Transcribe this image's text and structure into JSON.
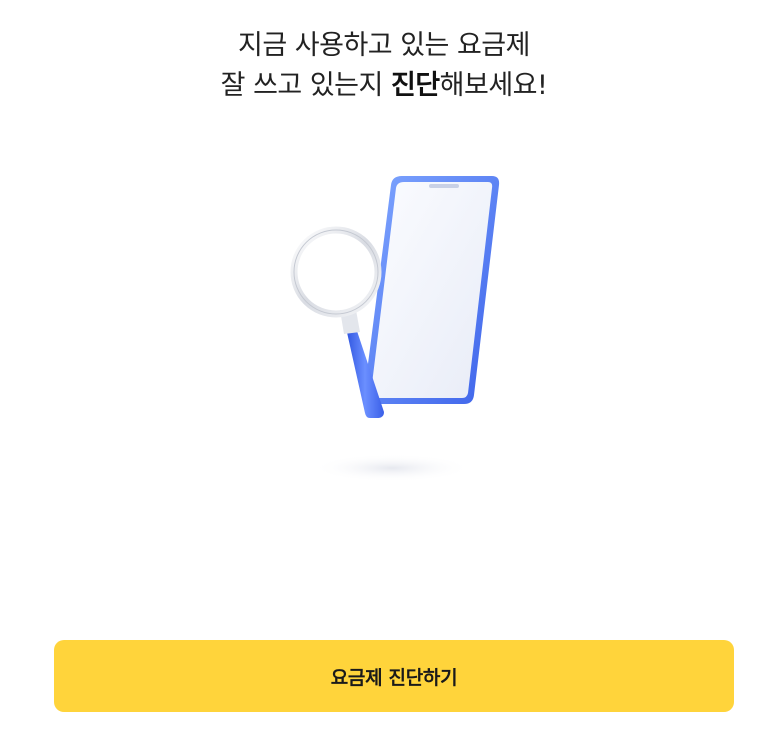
{
  "headline": {
    "line1": "지금 사용하고 있는 요금제",
    "line2_prefix": "잘 쓰고 있는지 ",
    "line2_bold": "진단",
    "line2_suffix": "해보세요!"
  },
  "illustration": {
    "phone": "phone-icon",
    "magnifier": "magnifying-glass-icon"
  },
  "cta": {
    "label": "요금제 진단하기",
    "color": "#ffd43b"
  }
}
